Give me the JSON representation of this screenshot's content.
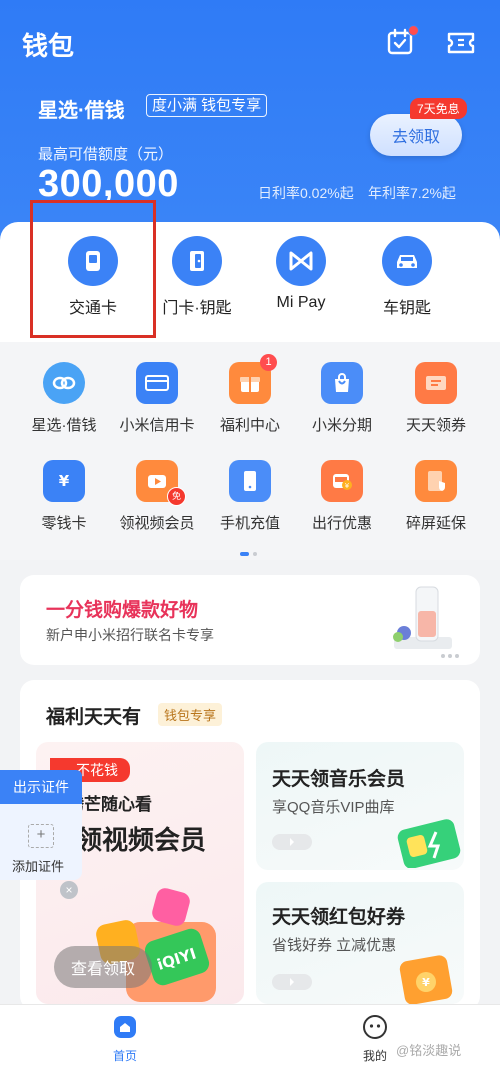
{
  "header": {
    "title": "钱包",
    "icons": [
      "calendar-check-icon",
      "ticket-icon"
    ]
  },
  "loan": {
    "title": "星选·借钱",
    "tag": "度小满 钱包专享",
    "limit_label": "最高可借额度（元）",
    "limit_amount": "300,000",
    "daily_rate": "日利率0.02%起",
    "annual_rate": "年利率7.2%起",
    "claim_button": "去领取",
    "free_badge": "7天免息"
  },
  "quick_actions": [
    {
      "label": "交通卡",
      "icon": "transit-card-icon"
    },
    {
      "label": "门卡·钥匙",
      "icon": "door-card-icon"
    },
    {
      "label": "Mi Pay",
      "icon": "mipay-icon"
    },
    {
      "label": "车钥匙",
      "icon": "car-key-icon"
    }
  ],
  "services_row1": [
    {
      "label": "星选·借钱",
      "icon": "loan-icon"
    },
    {
      "label": "小米信用卡",
      "icon": "credit-card-icon"
    },
    {
      "label": "福利中心",
      "icon": "gift-icon",
      "badge": "1"
    },
    {
      "label": "小米分期",
      "icon": "shopping-bag-icon"
    },
    {
      "label": "天天领券",
      "icon": "coupon-icon"
    }
  ],
  "services_row2": [
    {
      "label": "零钱卡",
      "icon": "yuan-card-icon"
    },
    {
      "label": "领视频会员",
      "icon": "video-vip-icon",
      "badge": "免"
    },
    {
      "label": "手机充值",
      "icon": "phone-recharge-icon"
    },
    {
      "label": "出行优惠",
      "icon": "travel-discount-icon"
    },
    {
      "label": "碎屏延保",
      "icon": "screen-warranty-icon"
    }
  ],
  "promo": {
    "title": "一分钱购爆款好物",
    "subtitle": "新户申小米招行联名卡专享"
  },
  "welfare": {
    "title": "福利天天有",
    "tag": "钱包专享",
    "left_card": {
      "badge": "不花钱",
      "line1": "优腾芒随心看",
      "line2": "元领视频会员",
      "button": "查看领取",
      "logo_text": "iQIYI"
    },
    "music_card": {
      "title": "天天领音乐会员",
      "subtitle": "享QQ音乐VIP曲库"
    },
    "redpacket_card": {
      "title": "天天领红包好券",
      "subtitle": "省钱好券 立减优惠"
    }
  },
  "certificate_panel": {
    "show_label": "出示证件",
    "plus": "+",
    "add_label": "添加证件",
    "close": "×"
  },
  "bottom_nav": [
    {
      "label": "首页",
      "icon": "home-icon",
      "active": true
    },
    {
      "label": "我的",
      "icon": "profile-icon",
      "active": false
    }
  ],
  "watermark": "@铭淡趣说",
  "colors": {
    "primary": "#2f7bf6",
    "promo_title": "#e8335a",
    "highlight": "#d93025"
  }
}
